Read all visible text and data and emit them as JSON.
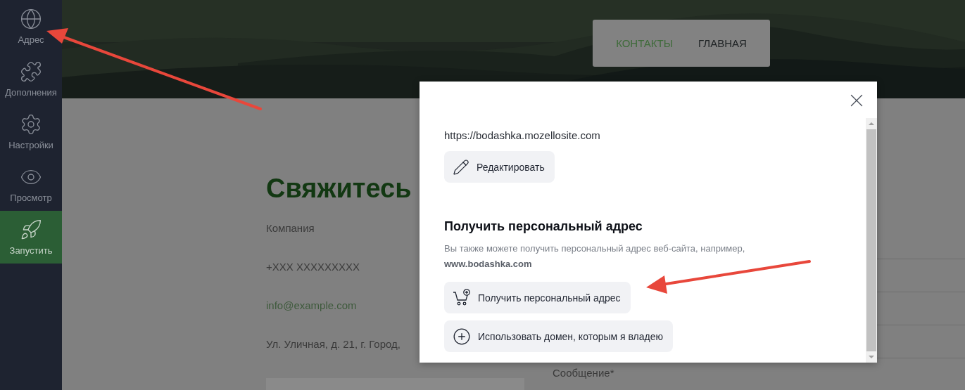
{
  "sidebar": {
    "items": [
      {
        "label": "Адрес",
        "kind": "globe"
      },
      {
        "label": "Дополнения",
        "kind": "puzzle"
      },
      {
        "label": "Настройки",
        "kind": "gear"
      },
      {
        "label": "Просмотр",
        "kind": "eye"
      },
      {
        "label": "Запустить",
        "kind": "launch"
      }
    ]
  },
  "header": {
    "nav": [
      {
        "label": "КОНТАКТЫ",
        "selected": true
      },
      {
        "label": "ГЛАВНАЯ",
        "selected": false
      }
    ]
  },
  "contact": {
    "title": "Свяжитесь",
    "lines": [
      {
        "text": "Компания",
        "kind": "text"
      },
      {
        "text": "+XXX XXXXXXXXX",
        "kind": "text"
      },
      {
        "text": "info@example.com",
        "kind": "link"
      },
      {
        "text": "Ул. Уличная, д. 21, г. Город,",
        "kind": "text"
      }
    ]
  },
  "form": {
    "label": "Сообщение*"
  },
  "dialog": {
    "url": "https://bodashka.mozellosite.com",
    "edit_button": "Редактировать",
    "heading": "Получить персональный адрес",
    "description": "Вы также можете получить персональный адрес веб-сайта, например, **www.bodashka.com**",
    "buttons": [
      {
        "label": "Получить персональный адрес",
        "kind": "cart"
      },
      {
        "label": "Использовать домен, которым я владею",
        "kind": "add"
      }
    ]
  }
}
